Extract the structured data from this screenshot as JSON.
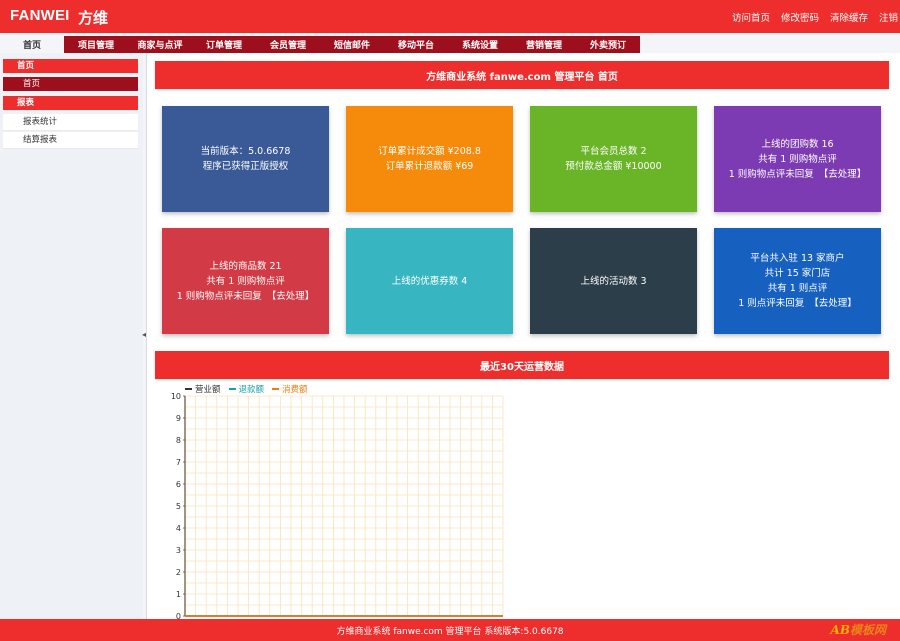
{
  "header": {
    "brand": "FANWEI",
    "brand_cn": "方维",
    "links": [
      "访问首页",
      "修改密码",
      "清除缓存",
      "注销"
    ]
  },
  "nav": {
    "tabs": [
      "首页",
      "项目管理",
      "商家与点评",
      "订单管理",
      "会员管理",
      "短信邮件",
      "移动平台",
      "系统设置",
      "营销管理",
      "外卖预订"
    ],
    "active": "首页"
  },
  "sidebar": {
    "section_home": "首页",
    "home_item": "首页",
    "section_report": "报表",
    "report_items": [
      "报表统计",
      "结算报表"
    ]
  },
  "main": {
    "title": "方维商业系统 fanwe.com 管理平台 首页",
    "cards": [
      {
        "lines": [
          "当前版本：5.0.6678",
          "程序已获得正版授权"
        ],
        "link": "",
        "color": "#3a5a97"
      },
      {
        "lines": [
          "订单累计成交额 ¥208.8",
          "订单累计退款额 ¥69"
        ],
        "link": "",
        "color": "#f58a0b"
      },
      {
        "lines": [
          "平台会员总数 2",
          "预付款总金额 ¥10000"
        ],
        "link": "",
        "color": "#6ab427"
      },
      {
        "lines": [
          "上线的团购数 16",
          "共有 1 则购物点评",
          "1 则购物点评未回复"
        ],
        "link": "【去处理】",
        "color": "#7d3bb3"
      },
      {
        "lines": [
          "上线的商品数 21",
          "共有 1 则购物点评",
          "1 则购物点评未回复"
        ],
        "link": "【去处理】",
        "color": "#d23b45"
      },
      {
        "lines": [
          "上线的优惠券数 4"
        ],
        "link": "",
        "color": "#37b6c2"
      },
      {
        "lines": [
          "上线的活动数 3"
        ],
        "link": "",
        "color": "#2d3e4b"
      },
      {
        "lines": [
          "平台共入驻 13 家商户",
          "共计 15 家门店",
          "共有 1 则点评",
          "1 则点评未回复"
        ],
        "link": "【去处理】",
        "color": "#1660bf"
      }
    ],
    "chart_title": "最近30天运营数据"
  },
  "chart_data": {
    "type": "line",
    "series": [
      {
        "name": "营业额",
        "color": "#333333",
        "values": [
          0,
          0,
          0,
          0,
          0,
          0,
          0,
          0,
          0,
          0,
          0,
          0,
          0,
          0,
          0,
          0,
          0,
          0,
          0,
          0,
          0,
          0,
          0,
          0,
          0,
          0,
          0,
          0,
          0,
          0
        ]
      },
      {
        "name": "退款额",
        "color": "#19a0a8",
        "values": [
          0,
          0,
          0,
          0,
          0,
          0,
          0,
          0,
          0,
          0,
          0,
          0,
          0,
          0,
          0,
          0,
          0,
          0,
          0,
          0,
          0,
          0,
          0,
          0,
          0,
          0,
          0,
          0,
          0,
          0
        ]
      },
      {
        "name": "消费额",
        "color": "#f07c10",
        "values": [
          0,
          0,
          0,
          0,
          0,
          0,
          0,
          0,
          0,
          0,
          0,
          0,
          0,
          0,
          0,
          0,
          0,
          0,
          0,
          0,
          0,
          0,
          0,
          0,
          0,
          0,
          0,
          0,
          0,
          0
        ]
      }
    ],
    "ylim": [
      0,
      10
    ],
    "yticks": [
      0,
      1,
      2,
      3,
      4,
      5,
      6,
      7,
      8,
      9,
      10
    ],
    "grid": true,
    "legend": "top-left",
    "grid_color": "#fbe2b8"
  },
  "footer": {
    "text": "方维商业系统 fanwe.com 管理平台 系统版本:5.0.6678"
  },
  "watermark": {
    "ab": "AB",
    "rest": "模板网"
  },
  "colors": {
    "brand_red": "#ee2d2d",
    "dark_red": "#9e0f1d"
  }
}
